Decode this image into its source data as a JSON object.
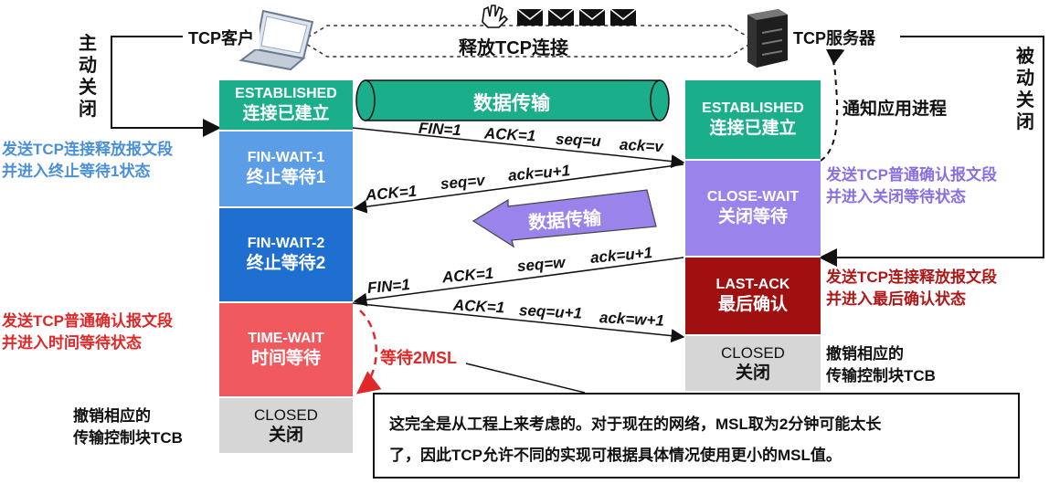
{
  "client": {
    "label": "TCP客户"
  },
  "server": {
    "label": "TCP服务器"
  },
  "release_label": "释放TCP连接",
  "active_close": "主\n动\n关\n闭",
  "passive_close": "被\n动\n关\n闭",
  "data_transfer": "数据传输",
  "notify_app": "通知应用进程",
  "client_states": [
    {
      "en": "ESTABLISHED",
      "zh": "连接已建立"
    },
    {
      "en": "FIN-WAIT-1",
      "zh": "终止等待1"
    },
    {
      "en": "FIN-WAIT-2",
      "zh": "终止等待2"
    },
    {
      "en": "TIME-WAIT",
      "zh": "时间等待"
    },
    {
      "en": "CLOSED",
      "zh": "关闭"
    }
  ],
  "server_states": [
    {
      "en": "ESTABLISHED",
      "zh": "连接已建立"
    },
    {
      "en": "CLOSE-WAIT",
      "zh": "关闭等待"
    },
    {
      "en": "LAST-ACK",
      "zh": "最后确认"
    },
    {
      "en": "CLOSED",
      "zh": "关闭"
    }
  ],
  "messages": [
    {
      "fields": [
        "FIN=1",
        "ACK=1",
        "seq=u",
        "ack=v"
      ]
    },
    {
      "fields": [
        "ACK=1",
        "seq=v",
        "ack=u+1"
      ]
    },
    {
      "fields": [
        "FIN=1",
        "ACK=1",
        "seq=w",
        "ack=u+1"
      ]
    },
    {
      "fields": [
        "ACK=1",
        "seq=u+1",
        "ack=w+1"
      ]
    }
  ],
  "notes": {
    "client_fin": [
      "发送TCP连接释放报文段",
      "并进入终止等待1状态"
    ],
    "client_ack": [
      "发送TCP普通确认报文段",
      "并进入时间等待状态"
    ],
    "server_ack": [
      "发送TCP普通确认报文段",
      "并进入关闭等待状态"
    ],
    "server_fin": [
      "发送TCP连接释放报文段",
      "并进入最后确认状态"
    ],
    "client_tcb": [
      "撤销相应的",
      "传输控制块TCB"
    ],
    "server_tcb": [
      "撤销相应的",
      "传输控制块TCB"
    ],
    "wait_2msl": "等待2MSL",
    "explanation": [
      "这完全是从工程上来考虑的。对于现在的网络，MSL取为2分钟可能太长",
      "了，因此TCP允许不同的实现可根据具体情况使用更小的MSL值。"
    ]
  },
  "colors": {
    "established": "#1aae8a",
    "fin_wait_1": "#5b9ee6",
    "fin_wait_2": "#1f6fd0",
    "time_wait": "#f05a5f",
    "closed": "#d6d6d6",
    "close_wait": "#9b83ec",
    "last_ack": "#a01010",
    "note_blue": "#4a90d9",
    "note_red": "#e02828",
    "note_purple": "#8a6fe0",
    "note_darkred": "#b01818"
  }
}
